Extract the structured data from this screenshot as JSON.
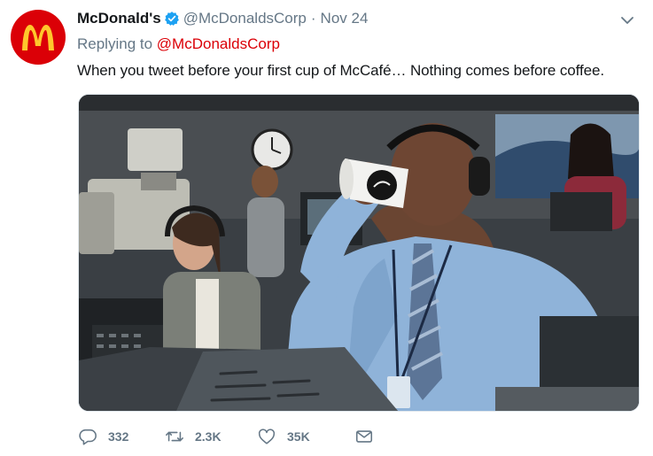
{
  "tweet": {
    "display_name": "McDonald's",
    "handle": "@McDonaldsCorp",
    "separator": "·",
    "date": "Nov 24",
    "replying_prefix": "Replying to",
    "replying_to": "@McDonaldsCorp",
    "text": "When you tweet before your first cup of McCafé… Nothing comes before coffee.",
    "verified": true
  },
  "actions": {
    "replies": "332",
    "retweets": "2.3K",
    "likes": "35K"
  },
  "icons": {
    "avatar": "mcdonalds-logo",
    "verified": "verified-badge-icon",
    "caret": "chevron-down-icon",
    "reply": "reply-icon",
    "retweet": "retweet-icon",
    "like": "heart-icon",
    "message": "envelope-icon"
  },
  "colors": {
    "brand_red": "#db0007",
    "logo_yellow": "#ffc72c",
    "verified_blue": "#1da1f2",
    "secondary_text": "#657786"
  }
}
